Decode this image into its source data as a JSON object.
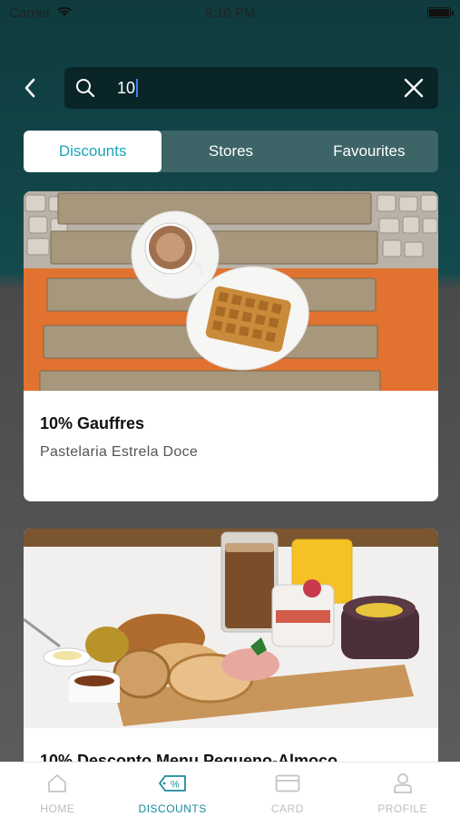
{
  "status_bar": {
    "carrier": "Carrier",
    "time": "9:10 PM"
  },
  "search": {
    "value": "10",
    "placeholder": ""
  },
  "tabs": [
    {
      "label": "Discounts",
      "active": true
    },
    {
      "label": "Stores",
      "active": false
    },
    {
      "label": "Favourites",
      "active": false
    }
  ],
  "results": [
    {
      "title": "10% Gauffres",
      "store": "Pastelaria Estrela Doce",
      "image": "waffle-coffee-photo"
    },
    {
      "title": "10% Desconto Menu Pequeno-Almoço",
      "store": "",
      "image": "breakfast-spread-photo"
    }
  ],
  "bottom_nav": [
    {
      "label": "HOME",
      "icon": "home-icon",
      "active": false
    },
    {
      "label": "DISCOUNTS",
      "icon": "discount-tag-icon",
      "active": true
    },
    {
      "label": "CARD",
      "icon": "card-icon",
      "active": false
    },
    {
      "label": "PROFILE",
      "icon": "profile-icon",
      "active": false
    }
  ],
  "colors": {
    "header_bg": "#0f3b3e",
    "accent": "#1aa6b7",
    "active_nav": "#1a8a9a"
  }
}
